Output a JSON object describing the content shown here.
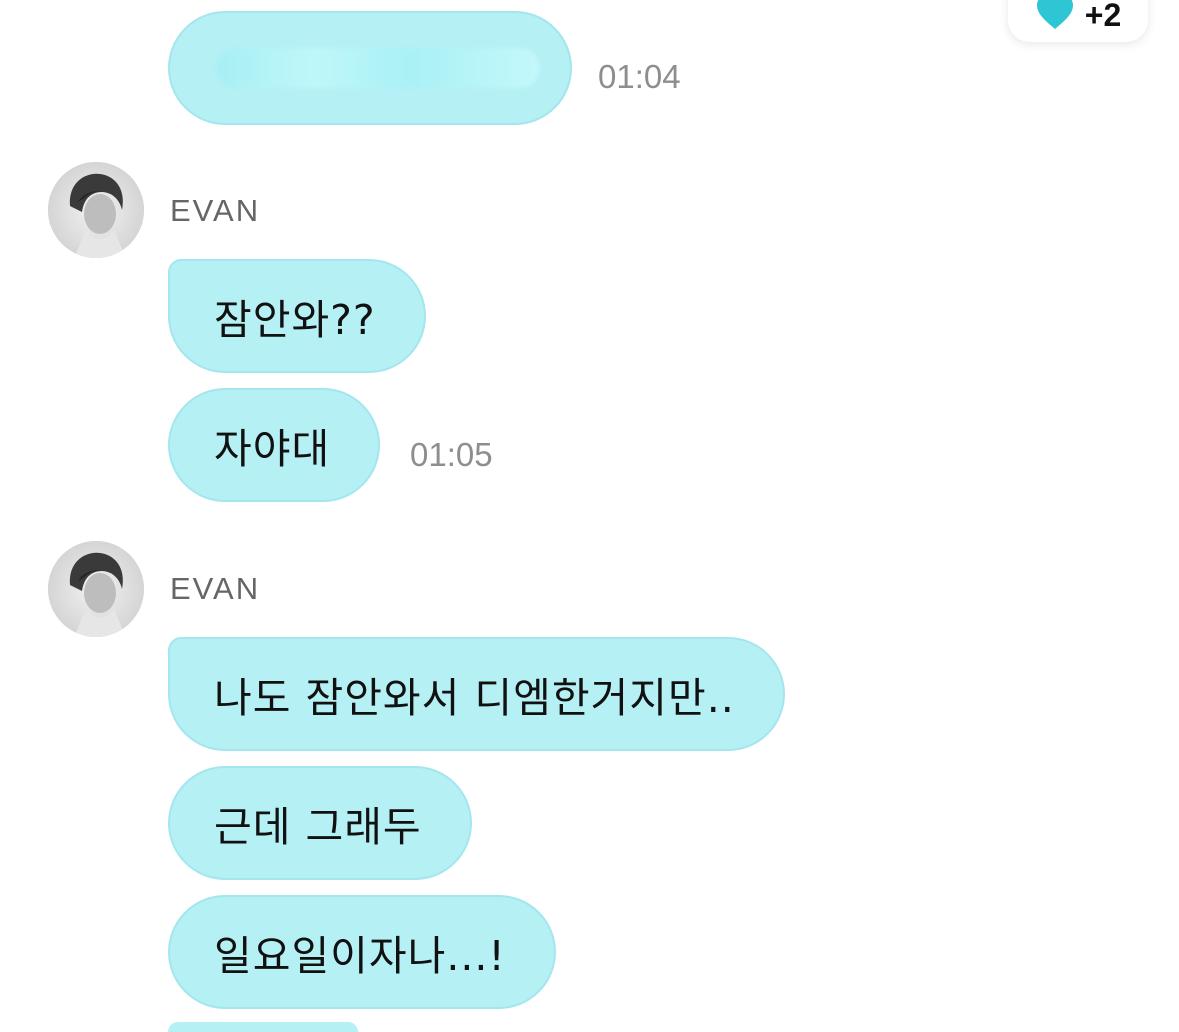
{
  "reward": {
    "icon": "heart-icon",
    "count": "+2"
  },
  "messages": [
    {
      "type": "outgoing-redacted",
      "time": "01:04"
    },
    {
      "sender": "EVAN",
      "bubbles": [
        "잠안와??",
        "자야대"
      ],
      "time": "01:05"
    },
    {
      "sender": "EVAN",
      "bubbles": [
        "나도 잠안와서 디엠한거지만..",
        "근데 그래두",
        "일요일이자나...!"
      ]
    }
  ],
  "colors": {
    "bubble": "#b5f0f5",
    "bubble_border": "#a4e6ee",
    "time": "#8e8e8e",
    "sender": "#666666",
    "heart": "#2ec6d4"
  }
}
